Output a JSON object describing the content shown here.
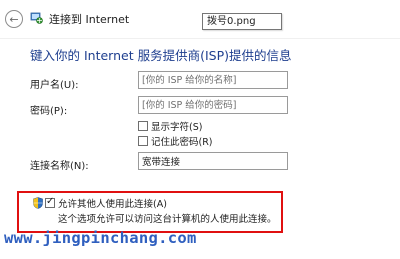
{
  "window": {
    "title": "连接到 Internet",
    "tooltip": "拨号0.png"
  },
  "heading": "键入你的 Internet 服务提供商(ISP)提供的信息",
  "form": {
    "username_label": "用户名(U):",
    "username_placeholder": "[你的 ISP 给你的名称]",
    "password_label": "密码(P):",
    "password_placeholder": "[你的 ISP 给你的密码]",
    "show_chars_label": "显示字符(S)",
    "show_chars_checked": false,
    "remember_label": "记住此密码(R)",
    "remember_checked": false,
    "conn_name_label": "连接名称(N):",
    "conn_name_value": "宽带连接"
  },
  "allow": {
    "label": "允许其他人使用此连接(A)",
    "checked": true,
    "description": "这个选项允许可以访问这台计算机的人使用此连接。"
  },
  "watermark": "www.jingpinchang.com",
  "icons": {
    "back": "back-arrow-icon",
    "app": "network-icon",
    "shield": "uac-shield-icon"
  },
  "colors": {
    "heading": "#1f3f8f",
    "highlight": "#e01010",
    "watermark": "#2f5fbf"
  }
}
